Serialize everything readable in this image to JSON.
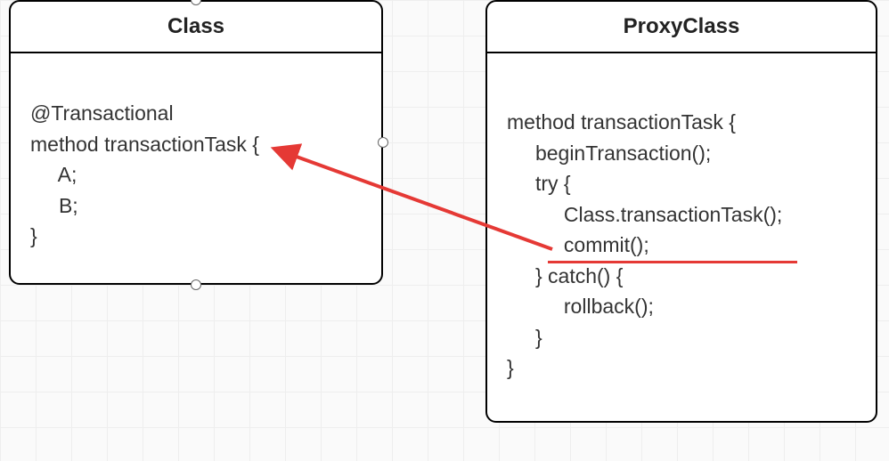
{
  "classes": {
    "class": {
      "title": "Class",
      "body": "@Transactional\nmethod transactionTask {\n     A;\n     B;\n}"
    },
    "proxy": {
      "title": "ProxyClass",
      "body": "method transactionTask {\n     beginTransaction();\n     try {\n          Class.transactionTask();\n          commit();\n     } catch() {\n          rollback();\n     }\n}"
    }
  },
  "arrow": {
    "color": "#e53935"
  }
}
